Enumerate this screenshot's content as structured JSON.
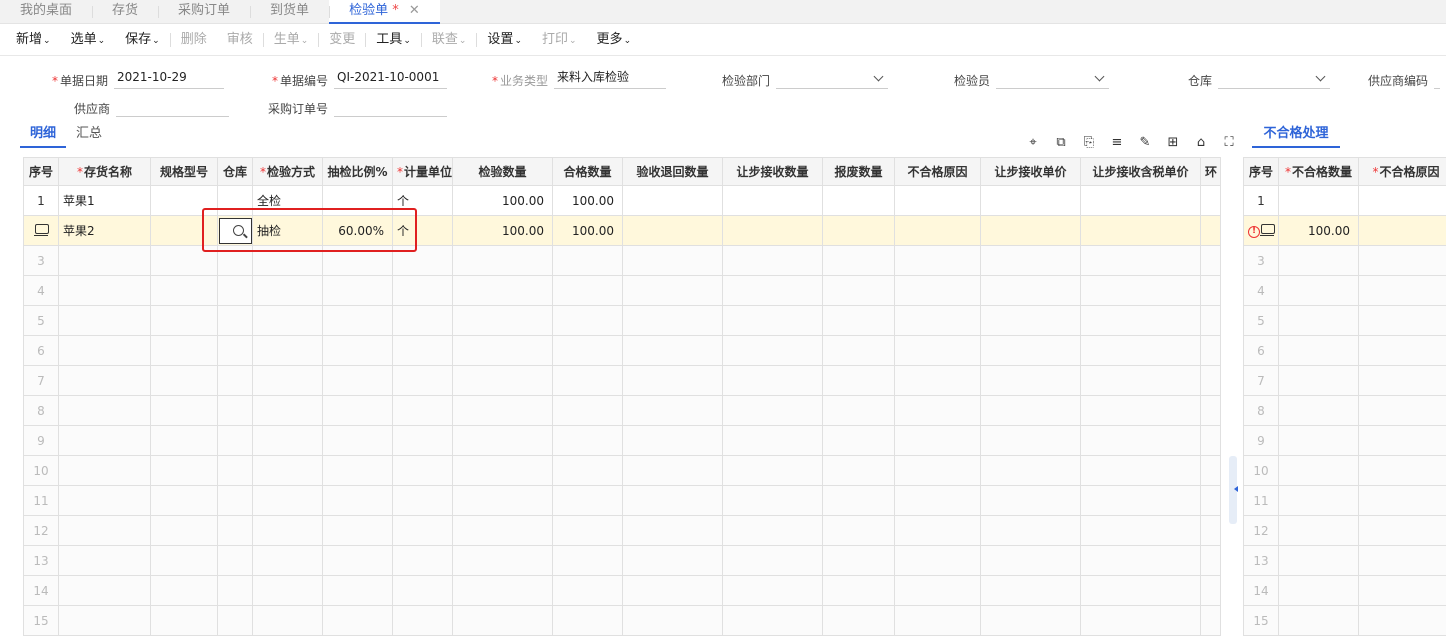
{
  "tabs": [
    {
      "label": "我的桌面",
      "active": false
    },
    {
      "label": "存货",
      "active": false
    },
    {
      "label": "采购订单",
      "active": false
    },
    {
      "label": "到货单",
      "active": false
    },
    {
      "label": "检验单",
      "active": true
    }
  ],
  "active_tab_modified": "*",
  "close_glyph": "✕",
  "toolbar": [
    {
      "label": "新增",
      "dropdown": true,
      "disabled": false
    },
    {
      "label": "选单",
      "dropdown": true,
      "disabled": false
    },
    {
      "label": "保存",
      "dropdown": true,
      "disabled": false
    },
    {
      "label": "删除",
      "dropdown": false,
      "disabled": true
    },
    {
      "label": "审核",
      "dropdown": false,
      "disabled": true
    },
    {
      "label": "生单",
      "dropdown": true,
      "disabled": true
    },
    {
      "label": "变更",
      "dropdown": false,
      "disabled": true
    },
    {
      "label": "工具",
      "dropdown": true,
      "disabled": false
    },
    {
      "label": "联查",
      "dropdown": true,
      "disabled": true
    },
    {
      "label": "设置",
      "dropdown": true,
      "disabled": false
    },
    {
      "label": "打印",
      "dropdown": true,
      "disabled": true
    },
    {
      "label": "更多",
      "dropdown": true,
      "disabled": false
    }
  ],
  "form": {
    "doc_date_label": "单据日期",
    "doc_date": "2021-10-29",
    "doc_no_label": "单据编号",
    "doc_no": "QI-2021-10-0001",
    "biz_type_label": "业务类型",
    "biz_type": "来料入库检验",
    "dept_label": "检验部门",
    "dept": "",
    "inspector_label": "检验员",
    "inspector": "",
    "warehouse_label": "仓库",
    "warehouse": "",
    "supplier_code_label": "供应商编码",
    "supplier_code": "",
    "supplier_label": "供应商",
    "supplier": "",
    "po_no_label": "采购订单号",
    "po_no": ""
  },
  "subtabs": {
    "detail": "明细",
    "summary": "汇总"
  },
  "right_tab": "不合格处理",
  "grid": {
    "columns": [
      "序号",
      "存货名称",
      "规格型号",
      "仓库",
      "检验方式",
      "抽检比例%",
      "计量单位",
      "检验数量",
      "合格数量",
      "验收退回数量",
      "让步接收数量",
      "报废数量",
      "不合格原因",
      "让步接收单价",
      "让步接收含税单价",
      "环"
    ],
    "rows": [
      {
        "idx": "1",
        "name": "苹果1",
        "spec": "",
        "warehouse": "",
        "method": "全检",
        "ratio": "",
        "unit": "个",
        "qty": "100.00",
        "pass": "100.00"
      },
      {
        "idx": "",
        "name": "苹果2",
        "spec": "",
        "warehouse": "",
        "method": "抽检",
        "ratio": "60.00%",
        "unit": "个",
        "qty": "100.00",
        "pass": "100.00"
      }
    ],
    "empty_rows": [
      "3",
      "4",
      "5",
      "6",
      "7",
      "8",
      "9",
      "10",
      "11",
      "12",
      "13",
      "14",
      "15"
    ]
  },
  "right_grid": {
    "columns": [
      "序号",
      "不合格数量",
      "不合格原因"
    ],
    "rows": [
      {
        "idx": "1",
        "qty": ""
      },
      {
        "idx": "",
        "qty": "100.00"
      }
    ],
    "empty_rows": [
      "3",
      "4",
      "5",
      "6",
      "7",
      "8",
      "9",
      "10",
      "11",
      "12",
      "13",
      "14",
      "15"
    ]
  }
}
